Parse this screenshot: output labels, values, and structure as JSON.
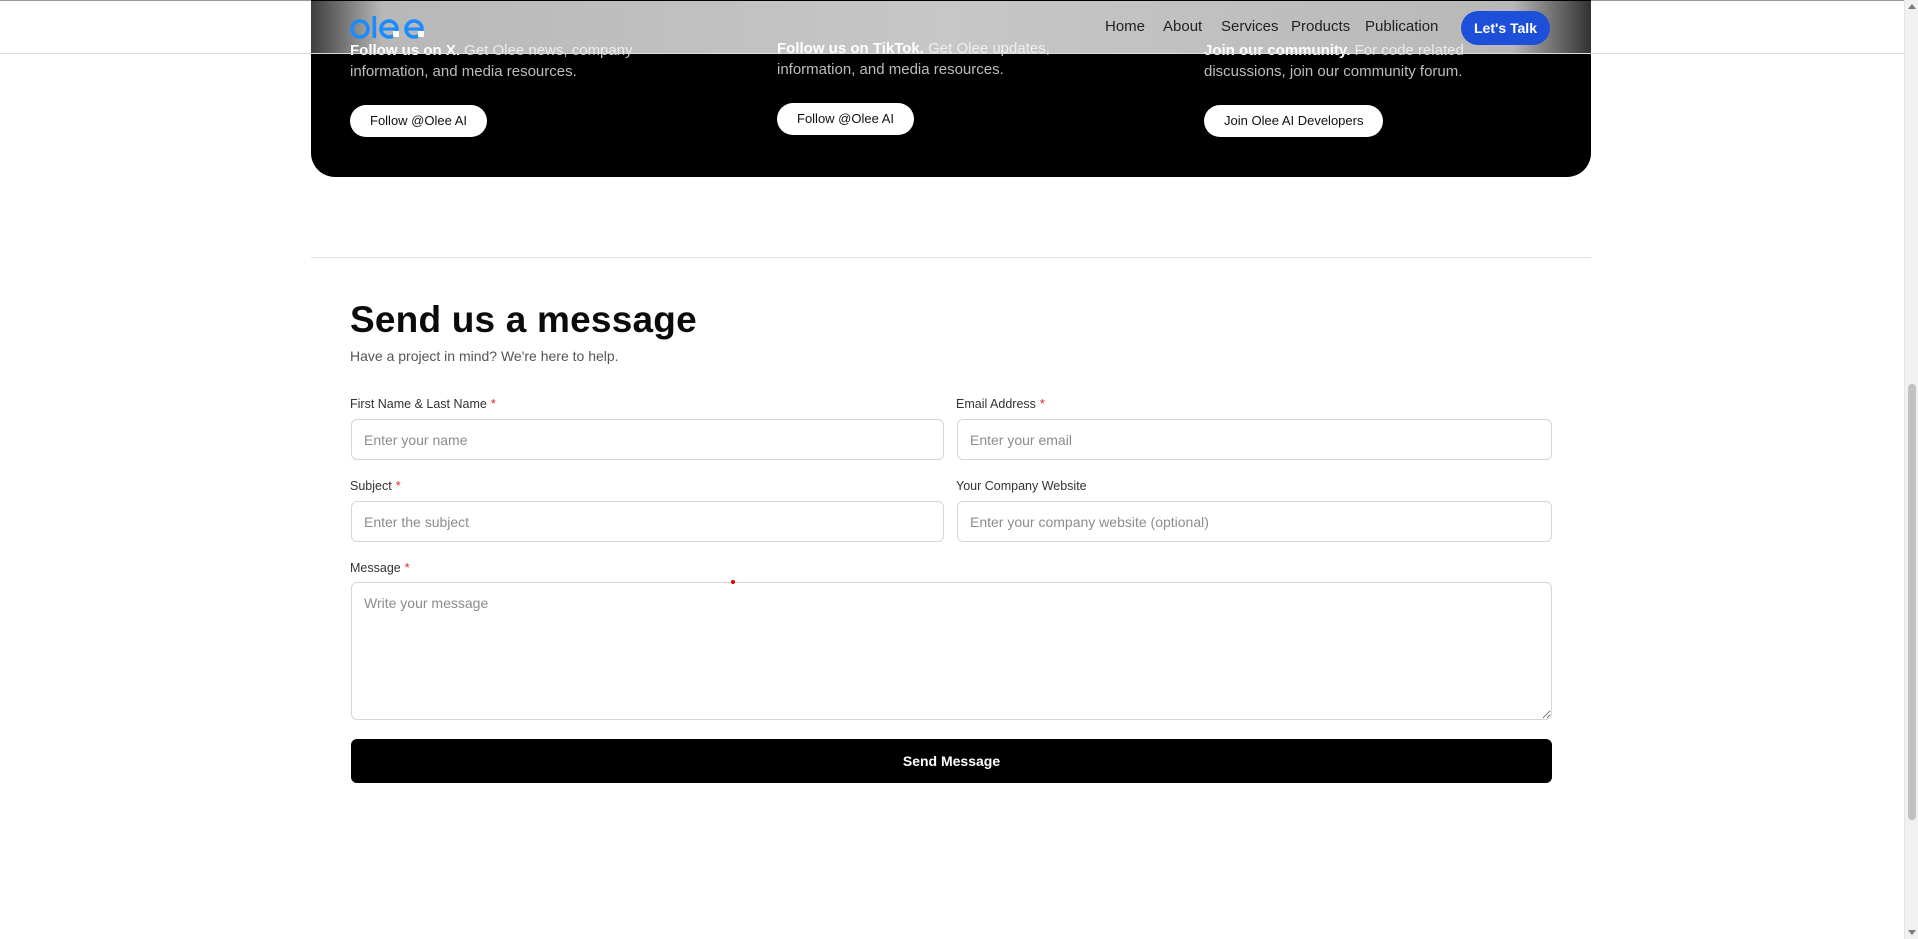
{
  "header": {
    "logo_text": "olee",
    "brand_color": "#1a8cff",
    "nav": [
      "Home",
      "About",
      "Services",
      "Products",
      "Publication"
    ],
    "cta_label": "Let's Talk",
    "cta_color": "#1e4fd8"
  },
  "community": {
    "columns": [
      {
        "title": "Follow us on X.",
        "text": "Get Olee news, company information, and media resources.",
        "button": "Follow @Olee AI"
      },
      {
        "title": "Follow us on TikTok.",
        "text": "Get Olee updates, information, and media resources.",
        "button": "Follow @Olee AI"
      },
      {
        "title": "Join our community.",
        "text": "For code related discussions, join our community forum.",
        "button": "Join Olee AI Developers"
      }
    ]
  },
  "form": {
    "title": "Send us a message",
    "subtitle": "Have a project in mind? We're here to help.",
    "required_marker": "*",
    "name_label": "First Name & Last Name",
    "name_placeholder": "Enter your name",
    "email_label": "Email Address",
    "email_placeholder": "Enter your email",
    "subject_label": "Subject",
    "subject_placeholder": "Enter the subject",
    "website_label": "Your Company Website",
    "website_placeholder": "Enter your company website (optional)",
    "message_label": "Message",
    "message_placeholder": "Write your message",
    "submit_label": "Send Message"
  }
}
